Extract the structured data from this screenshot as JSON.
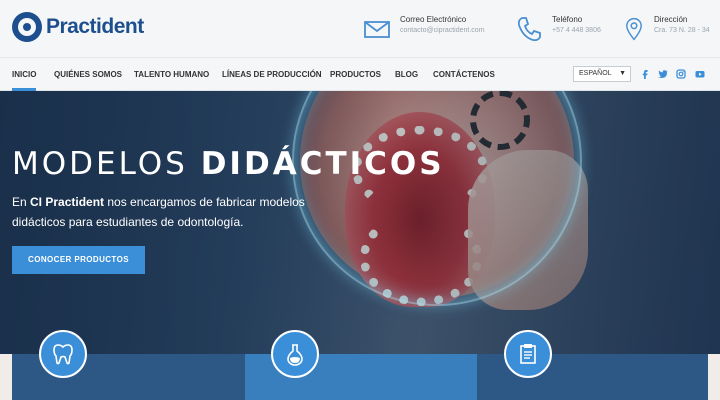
{
  "header": {
    "brand": "Practident",
    "contacts": [
      {
        "label": "Correo Electrónico",
        "value": "contacto@cipractident.com",
        "icon": "envelope-icon"
      },
      {
        "label": "Teléfono",
        "value": "+57 4 448 3806",
        "icon": "phone-icon"
      },
      {
        "label": "Dirección",
        "value": "Cra. 73 N. 28 - 34",
        "icon": "map-pin-icon"
      }
    ]
  },
  "nav": {
    "items": [
      "INICIO",
      "QUIÉNES SOMOS",
      "TALENTO HUMANO",
      "LÍNEAS DE PRODUCCIÓN",
      "PRODUCTOS",
      "BLOG",
      "CONTÁCTENOS"
    ],
    "active": "INICIO",
    "language": "ESPAÑOL",
    "social": [
      "facebook-icon",
      "twitter-icon",
      "instagram-icon",
      "youtube-icon"
    ]
  },
  "hero": {
    "title_light": "MODELOS ",
    "title_bold": "DIDÁCTICOS",
    "text_prefix": "En ",
    "text_bold": "CI Practident",
    "text_rest": " nos encargamos de fabricar modelos didácticos para estudiantes de odontología.",
    "button": "CONOCER PRODUCTOS"
  },
  "features": [
    {
      "icon": "tooth-icon"
    },
    {
      "icon": "flask-icon"
    },
    {
      "icon": "clipboard-icon"
    }
  ],
  "colors": {
    "accent": "#3b8fd8",
    "brand": "#1d4f8f",
    "card_dark": "#2d5784",
    "card_mid": "#3a7fbd"
  }
}
